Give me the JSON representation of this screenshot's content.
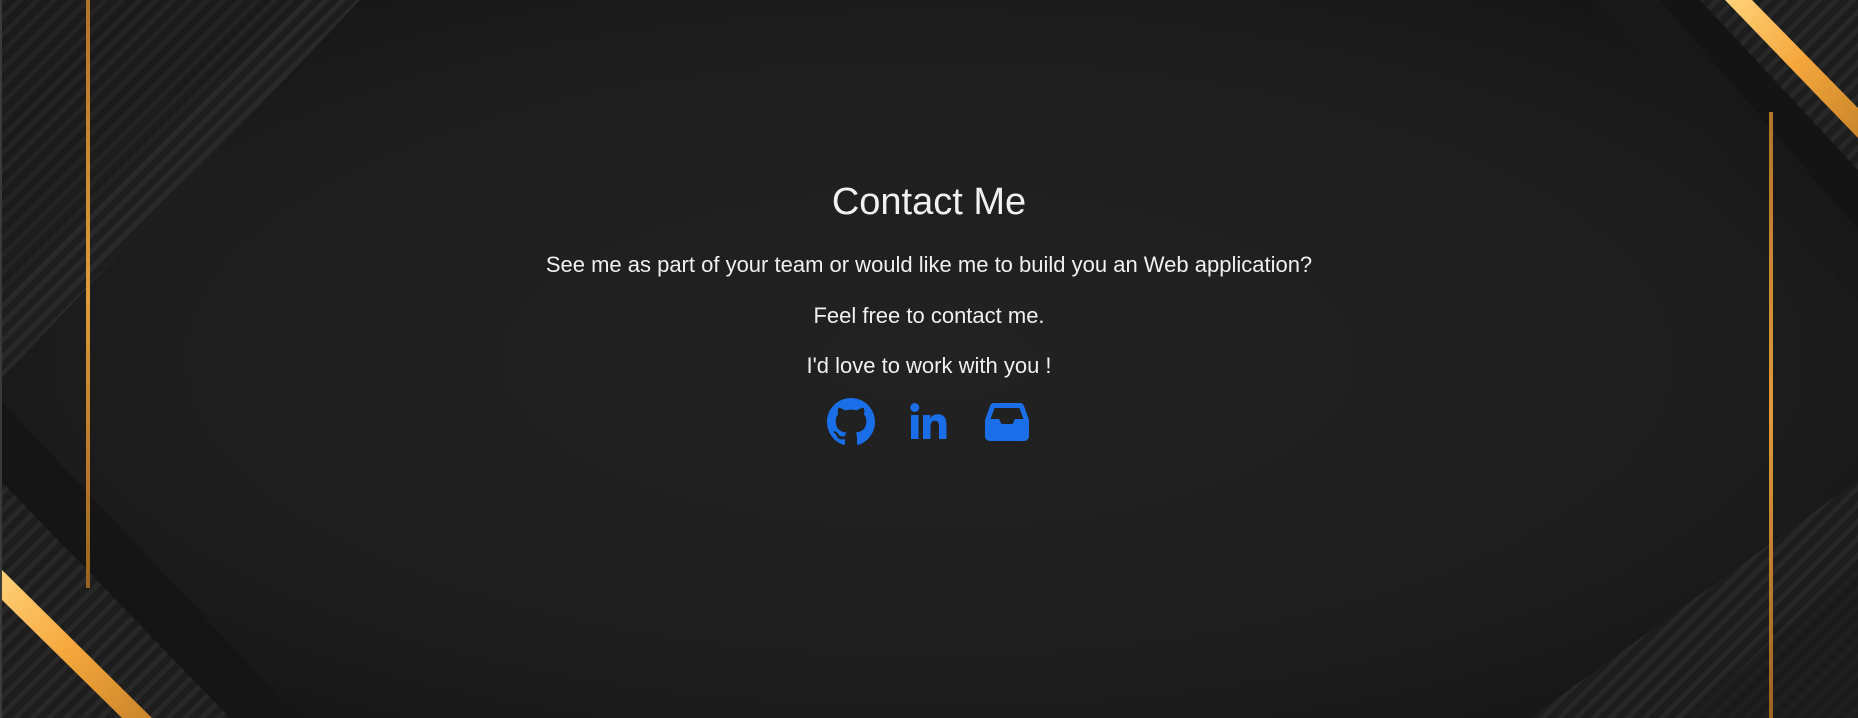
{
  "contact": {
    "title": "Contact Me",
    "line1": "See me as part of your team or would like me to build you an Web application?",
    "line2": "Feel free to contact me.",
    "line3": "I'd love to work with you !"
  },
  "social": {
    "icons": [
      "github-icon",
      "linkedin-icon",
      "inbox-icon"
    ],
    "icon_color": "#1a6fe8"
  },
  "theme": {
    "background": "#1b1b1b",
    "accent_gold": "#f5b24a",
    "text": "#f2f2f2"
  }
}
